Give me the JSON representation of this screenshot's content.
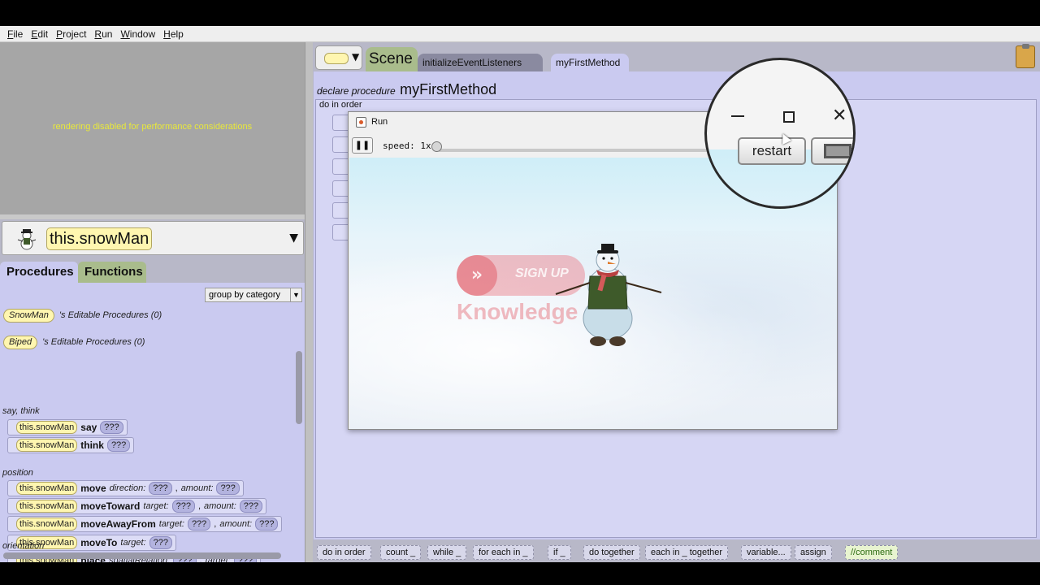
{
  "menu": [
    "File",
    "Edit",
    "Project",
    "Run",
    "Window",
    "Help"
  ],
  "preview": {
    "message": "rendering disabled for performance considerations"
  },
  "object_selector": {
    "selected": "this.snowMan",
    "icon": "snowman-icon"
  },
  "left_tabs": {
    "procedures": "Procedures",
    "functions": "Functions"
  },
  "palette": {
    "group_by": "group by category",
    "editable": [
      {
        "class": "SnowMan",
        "text": "'s Editable Procedures (0)"
      },
      {
        "class": "Biped",
        "text": "'s Editable Procedures (0)"
      }
    ],
    "categories": {
      "say_think": "say, think",
      "position": "position",
      "orientation": "orientation"
    },
    "statements": [
      {
        "obj": "this.snowMan",
        "method": "say",
        "params": [
          {
            "label": "",
            "value": "???"
          }
        ]
      },
      {
        "obj": "this.snowMan",
        "method": "think",
        "params": [
          {
            "label": "",
            "value": "???"
          }
        ]
      },
      {
        "obj": "this.snowMan",
        "method": "move",
        "params": [
          {
            "label": "direction:",
            "value": "???"
          },
          {
            "label": "amount:",
            "value": "???"
          }
        ]
      },
      {
        "obj": "this.snowMan",
        "method": "moveToward",
        "params": [
          {
            "label": "target:",
            "value": "???"
          },
          {
            "label": "amount:",
            "value": "???"
          }
        ]
      },
      {
        "obj": "this.snowMan",
        "method": "moveAwayFrom",
        "params": [
          {
            "label": "target:",
            "value": "???"
          },
          {
            "label": "amount:",
            "value": "???"
          }
        ]
      },
      {
        "obj": "this.snowMan",
        "method": "moveTo",
        "params": [
          {
            "label": "target:",
            "value": "???"
          }
        ]
      },
      {
        "obj": "this.snowMan",
        "method": "place",
        "params": [
          {
            "label": "spatialRelation:",
            "value": "???"
          },
          {
            "label": "target:",
            "value": "???"
          }
        ]
      }
    ]
  },
  "editor": {
    "tabs": {
      "scene": "Scene",
      "init": "initializeEventListeners",
      "current": "myFirstMethod"
    },
    "declare_label": "declare procedure",
    "method_name": "myFirstMethod",
    "do_in_order": "do in order"
  },
  "bottom_bar": [
    "do in order",
    "count _",
    "while _",
    "for each in _",
    "if _",
    "do together",
    "each in _ together",
    "variable...",
    "assign",
    "//comment"
  ],
  "run_window": {
    "title": "Run",
    "pause_glyph": "❚❚",
    "speed_label": "speed: 1x",
    "speed": 1,
    "restart": "restart",
    "close_glyph": "✕"
  },
  "watermark": {
    "cta": "SIGN UP",
    "brand": "Knowledge",
    "arrow_glyph": "»"
  }
}
